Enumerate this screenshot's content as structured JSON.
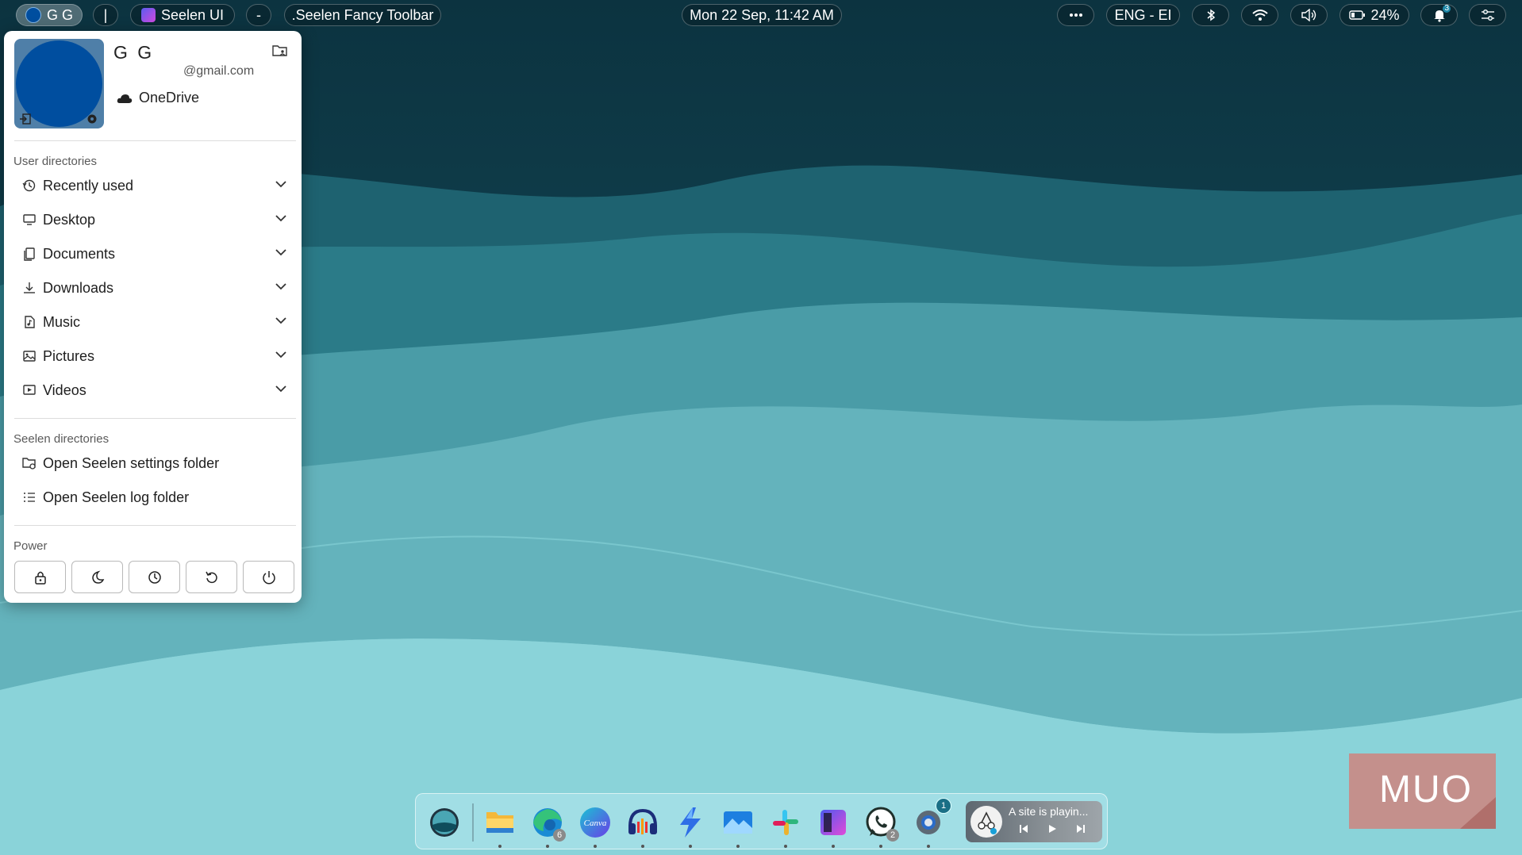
{
  "topbar": {
    "user_label": "G G",
    "separator": "|",
    "app_name": "Seelen UI",
    "dash": "-",
    "window_title": ".Seelen Fancy Toolbar",
    "datetime": "Mon 22 Sep, 11:42 AM",
    "more_label": "···",
    "language": "ENG - EI",
    "battery": "24%",
    "notifications_count": "3"
  },
  "user_menu": {
    "name": "G G",
    "email": "@gmail.com",
    "onedrive_label": "OneDrive",
    "user_dirs_title": "User directories",
    "user_dirs": [
      {
        "label": "Recently used",
        "icon": "history-icon"
      },
      {
        "label": "Desktop",
        "icon": "monitor-icon"
      },
      {
        "label": "Documents",
        "icon": "documents-icon"
      },
      {
        "label": "Downloads",
        "icon": "download-icon"
      },
      {
        "label": "Music",
        "icon": "music-file-icon"
      },
      {
        "label": "Pictures",
        "icon": "image-icon"
      },
      {
        "label": "Videos",
        "icon": "video-icon"
      }
    ],
    "seelen_dirs_title": "Seelen directories",
    "seelen_dirs": [
      {
        "label": "Open Seelen settings folder",
        "icon": "folder-gear-icon"
      },
      {
        "label": "Open Seelen log folder",
        "icon": "list-icon"
      }
    ],
    "power_title": "Power",
    "power_buttons": [
      "lock-icon",
      "sleep-icon",
      "hibernate-icon",
      "restart-icon",
      "shutdown-icon"
    ]
  },
  "dock": {
    "apps": [
      {
        "name": "seelen-start",
        "running": false
      },
      {
        "name": "file-explorer",
        "running": true
      },
      {
        "name": "edge",
        "running": true,
        "count": "6"
      },
      {
        "name": "canva",
        "running": true,
        "label": "Canva"
      },
      {
        "name": "audacity",
        "running": true
      },
      {
        "name": "power-automate",
        "running": true
      },
      {
        "name": "photos",
        "running": true
      },
      {
        "name": "slack",
        "running": true
      },
      {
        "name": "seelen-ui",
        "running": true
      },
      {
        "name": "whatsapp",
        "running": true,
        "count": "2"
      },
      {
        "name": "settings",
        "running": true,
        "notification": "1"
      }
    ],
    "media": {
      "title": "A site is playin..."
    }
  },
  "watermark": {
    "text": "MUO"
  },
  "colors": {
    "accent_blue": "#004e9f",
    "wallpaper_dark": "#0e3a45",
    "wallpaper_light": "#8fd7dd"
  }
}
